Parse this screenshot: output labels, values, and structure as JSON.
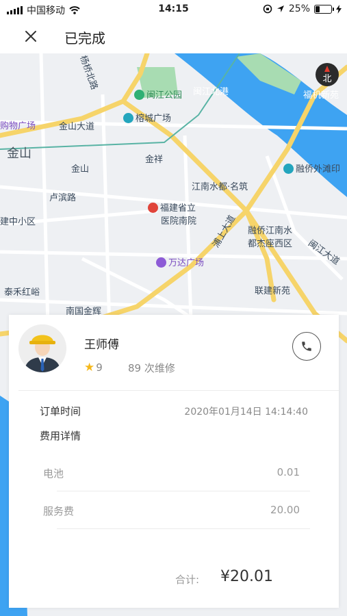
{
  "status_bar": {
    "carrier": "中国移动",
    "time": "14:15",
    "battery": "25%",
    "battery_level": 0.25
  },
  "nav": {
    "title": "已完成",
    "close_icon": "close-icon"
  },
  "map": {
    "compass_label": "北",
    "labels": {
      "park": "闽江公园",
      "river_road": "闽江北港",
      "fuzhou_new": "福机新苑",
      "rongcheng": "榕城广场",
      "shopping": "购物广场",
      "jinshan_ave": "金山大道",
      "jinshan": "金山",
      "jinshan_area": "金山",
      "jinxiang": "金祥",
      "jiangnan": "江南水都·名筑",
      "rongqiao_beach": "融侨外滩印",
      "lubin_road": "卢滨路",
      "hospital_1": "福建省立",
      "hospital_2": "医院南院",
      "school": "建中小区",
      "rongqiao_1": "融侨江南水",
      "rongqiao_2": "都杰座西区",
      "pushang": "浦上大道",
      "wanda": "万达广场",
      "minjiang_ave": "闽江大道",
      "taihe": "泰禾红峪",
      "lianjian": "联建新苑",
      "nanguo": "南国金辉",
      "north_road": "杨桥北路"
    }
  },
  "master": {
    "name": "王师傅",
    "rating": "9",
    "repairs": "89 次维修"
  },
  "order": {
    "time_label": "订单时间",
    "time_value": "2020年01月14日 14:14:40",
    "fee_detail_label": "费用详情",
    "fees": [
      {
        "name": "电池",
        "amount": "0.01"
      },
      {
        "name": "服务费",
        "amount": "20.00"
      }
    ],
    "total_label": "合计:",
    "total_value": "¥20.01"
  },
  "colors": {
    "water": "#3ea3f2",
    "road_major": "#f6d46a",
    "park": "#a8dcb2",
    "star": "#f5b81c"
  }
}
